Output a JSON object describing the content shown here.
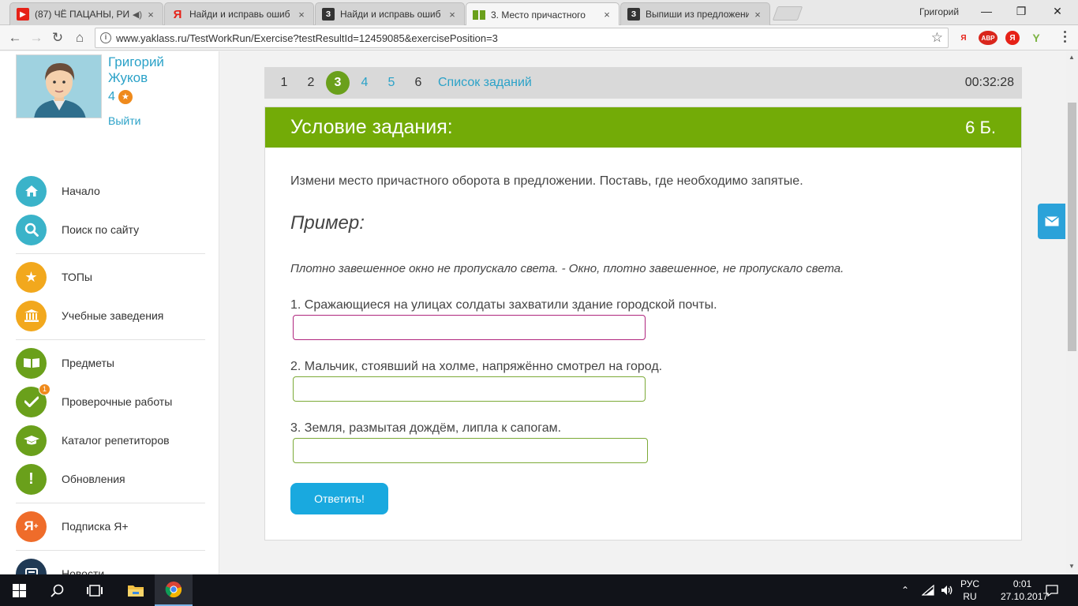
{
  "browser": {
    "tabs": [
      {
        "title": "(87) ЧЁ ПАЦАНЫ, РИ",
        "favicon": "youtube-icon",
        "audio": true
      },
      {
        "title": "Найди и исправь ошиб",
        "favicon": "yandex-icon"
      },
      {
        "title": "Найди и исправь ошиб",
        "favicon": "znanija-icon"
      },
      {
        "title": "3. Место причастного",
        "favicon": "yaklass-icon",
        "active": true
      },
      {
        "title": "Выпиши из предложени",
        "favicon": "znanija-icon"
      }
    ],
    "profile_name": "Григорий",
    "url": "www.yaklass.ru/TestWorkRun/Exercise?testResultId=12459085&exercisePosition=3",
    "extensions": [
      "Я",
      "ABP",
      "Я",
      "Y"
    ]
  },
  "user": {
    "first_name": "Григорий",
    "last_name": "Жуков",
    "points": "4",
    "logout": "Выйти"
  },
  "menu": {
    "items": [
      {
        "label": "Начало",
        "icon": "home-icon",
        "color": "#3ab3c9"
      },
      {
        "label": "Поиск по сайту",
        "icon": "search-icon",
        "color": "#3ab3c9"
      },
      {
        "label": "ТОПы",
        "icon": "star-icon",
        "color": "#f2a81d"
      },
      {
        "label": "Учебные заведения",
        "icon": "institution-icon",
        "color": "#f2a81d"
      },
      {
        "label": "Предметы",
        "icon": "book-icon",
        "color": "#6aa01b"
      },
      {
        "label": "Проверочные работы",
        "icon": "check-icon",
        "color": "#6aa01b",
        "badge": "1"
      },
      {
        "label": "Каталог репетиторов",
        "icon": "graduation-cap-icon",
        "color": "#6aa01b"
      },
      {
        "label": "Обновления",
        "icon": "exclamation-icon",
        "color": "#6aa01b"
      },
      {
        "label": "Подписка Я+",
        "icon": "ya-plus-icon",
        "color": "#ef6c2a"
      },
      {
        "label": "Новости",
        "icon": "news-icon",
        "color": "#203a55"
      }
    ]
  },
  "exercise": {
    "nav": [
      "1",
      "2",
      "3",
      "4",
      "5",
      "6"
    ],
    "current": "3",
    "task_list": "Список заданий",
    "timer": "00:32:28",
    "title": "Условие задания:",
    "points": "6 Б.",
    "instruction": "Измени место причастного оборота в предложении. Поставь, где необходимо запятые.",
    "example_heading": "Пример:",
    "example_text": "Плотно завешенное окно не пропускало света. - Окно, плотно завешенное, не пропускало света.",
    "tasks": [
      {
        "text": "1. Сражающиеся на улицах солдаты захватили здание городской почты.",
        "value": ""
      },
      {
        "text": "2. Мальчик, стоявший на холме, напряжённо смотрел на город.",
        "value": ""
      },
      {
        "text": "3. Земля, размытая дождём, липла к сапогам.",
        "value": ""
      }
    ],
    "submit": "Ответить!"
  },
  "taskbar": {
    "lang_top": "РУС",
    "lang_bottom": "RU",
    "time": "0:01",
    "date": "27.10.2017"
  },
  "colors": {
    "accent_green": "#73ab07",
    "link_blue": "#2ba2c8",
    "submit_blue": "#19a9df"
  }
}
